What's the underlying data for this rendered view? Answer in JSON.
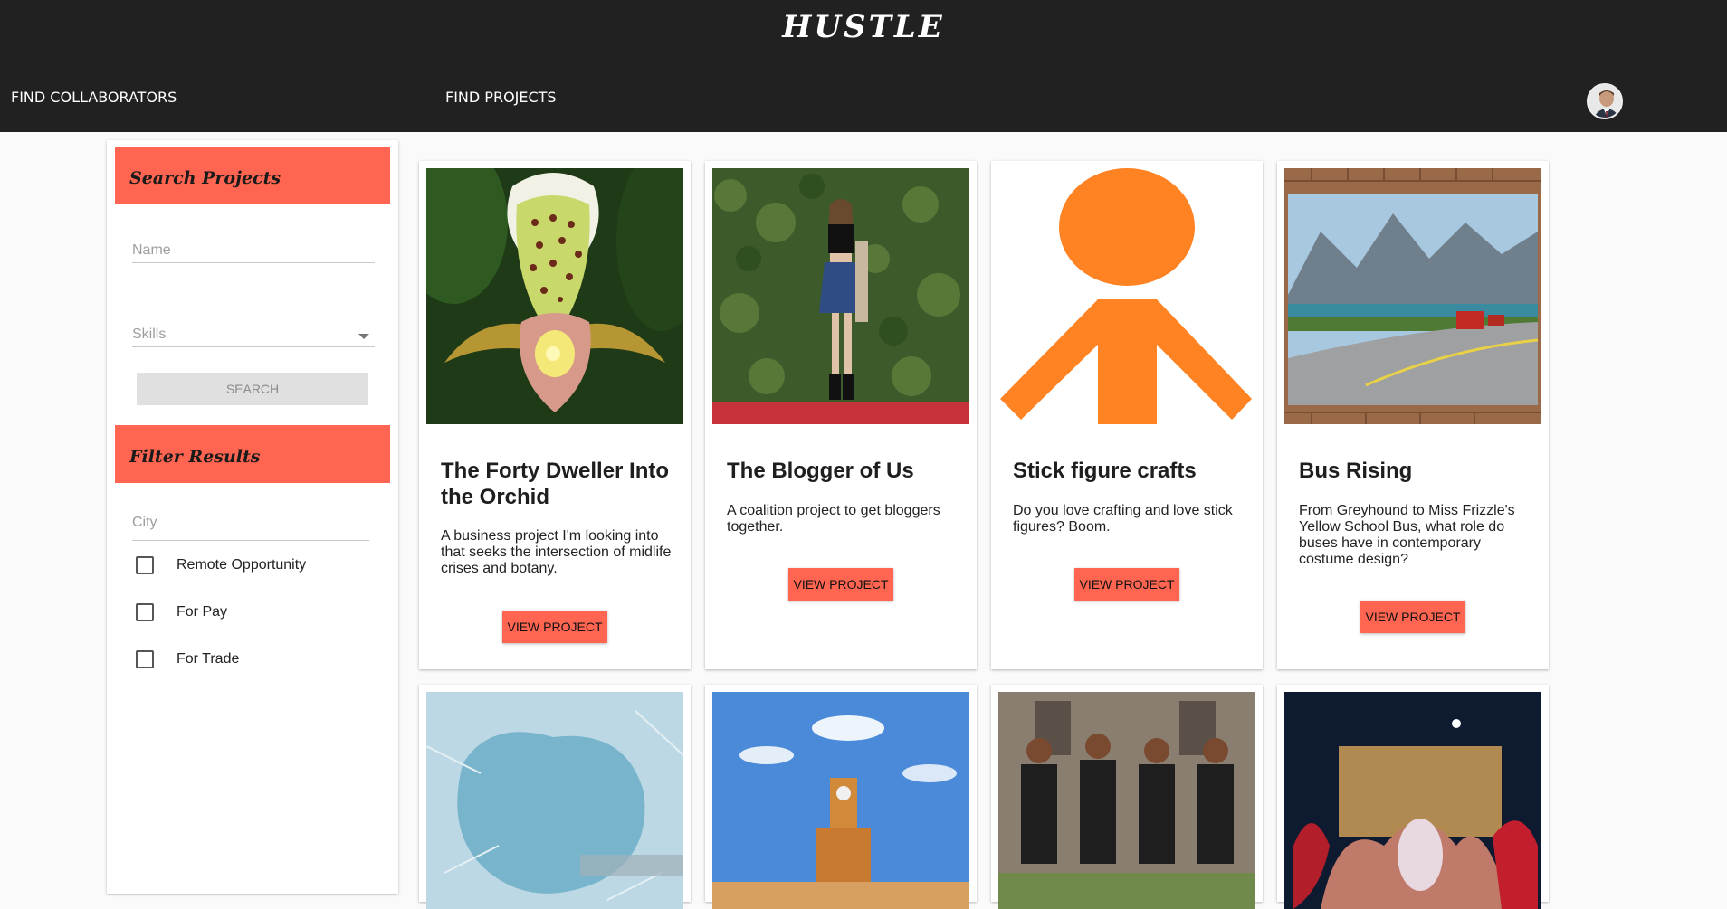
{
  "header": {
    "brand": "HUSTLE",
    "nav": {
      "find_collaborators": "FIND COLLABORATORS",
      "find_projects": "FIND PROJECTS"
    }
  },
  "sidebar": {
    "search_heading": "Search Projects",
    "name_placeholder": "Name",
    "skills_placeholder": "Skills",
    "search_button": "SEARCH",
    "filter_heading": "Filter Results",
    "city_placeholder": "City",
    "filters": [
      {
        "label": "Remote Opportunity",
        "checked": false
      },
      {
        "label": "For Pay",
        "checked": false
      },
      {
        "label": "For Trade",
        "checked": false
      }
    ]
  },
  "projects": [
    {
      "title": "The Forty Dweller Into the Orchid",
      "description": "A business project I'm looking into that seeks the intersection of midlife crises and botany.",
      "button": "VIEW PROJECT"
    },
    {
      "title": "The Blogger of Us",
      "description": "A coalition project to get bloggers together.",
      "button": "VIEW PROJECT"
    },
    {
      "title": "Stick figure crafts",
      "description": "Do you love crafting and love stick figures? Boom.",
      "button": "VIEW PROJECT"
    },
    {
      "title": "Bus Rising",
      "description": "From Greyhound to Miss Frizzle's Yellow School Bus, what role do buses have in contemporary costume design?",
      "button": "VIEW PROJECT"
    }
  ],
  "colors": {
    "header_bg": "#212121",
    "accent": "#ff6550",
    "page_bg": "#fafafa"
  }
}
